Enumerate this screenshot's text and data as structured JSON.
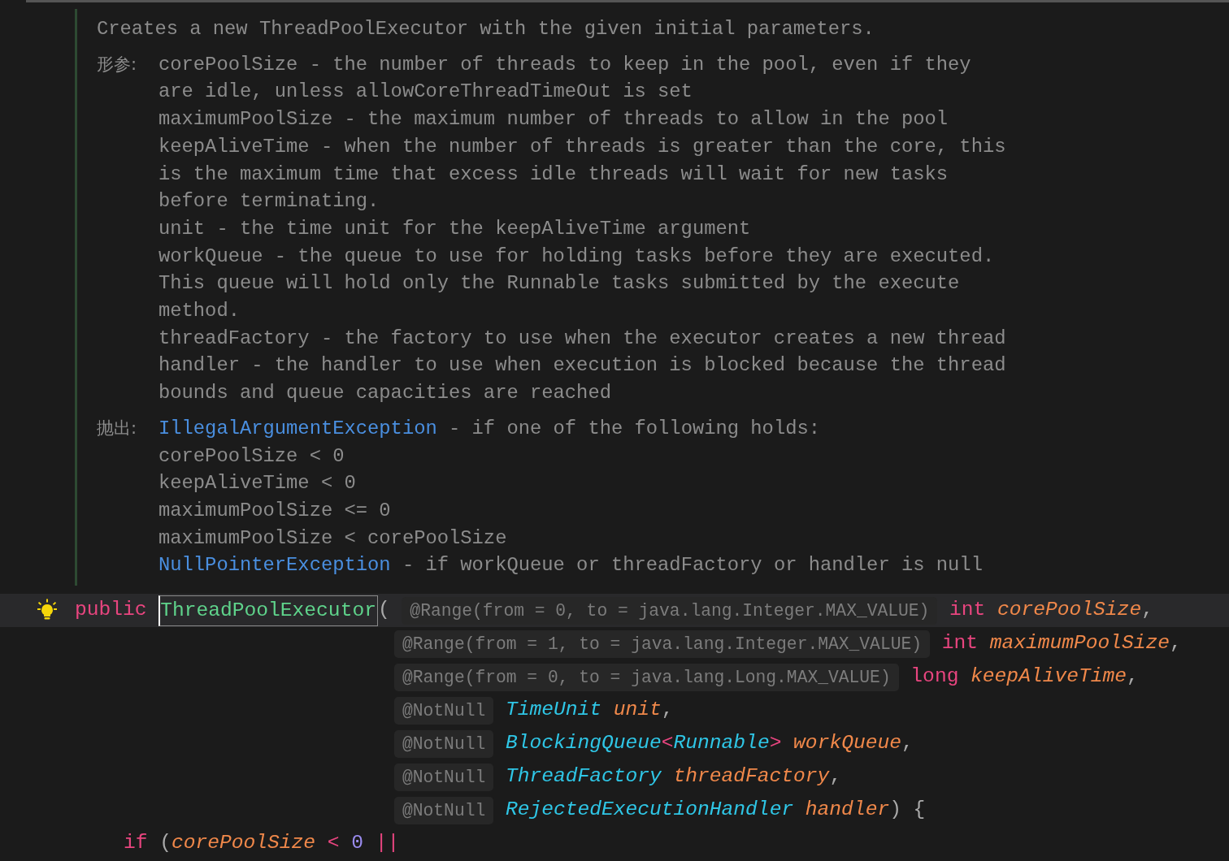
{
  "doc": {
    "summary": "Creates a new ThreadPoolExecutor with the given initial parameters.",
    "sections": [
      {
        "label": "形参:",
        "lines": [
          [
            {
              "text": "corePoolSize - the number of threads to keep in the pool, even if they",
              "kind": "text"
            }
          ],
          [
            {
              "text": "are idle, unless allowCoreThreadTimeOut is set",
              "kind": "text"
            }
          ],
          [
            {
              "text": "maximumPoolSize - the maximum number of threads to allow in the pool",
              "kind": "text"
            }
          ],
          [
            {
              "text": "keepAliveTime - when the number of threads is greater than the core, this",
              "kind": "text"
            }
          ],
          [
            {
              "text": "is the maximum time that excess idle threads will wait for new tasks",
              "kind": "text"
            }
          ],
          [
            {
              "text": "before terminating.",
              "kind": "text"
            }
          ],
          [
            {
              "text": "unit - the time unit for the keepAliveTime argument",
              "kind": "text"
            }
          ],
          [
            {
              "text": "workQueue - the queue to use for holding tasks before they are executed.",
              "kind": "text"
            }
          ],
          [
            {
              "text": "This queue will hold only the Runnable tasks submitted by the execute",
              "kind": "text"
            }
          ],
          [
            {
              "text": "method.",
              "kind": "text"
            }
          ],
          [
            {
              "text": "threadFactory - the factory to use when the executor creates a new thread",
              "kind": "text"
            }
          ],
          [
            {
              "text": "handler - the handler to use when execution is blocked because the thread",
              "kind": "text"
            }
          ],
          [
            {
              "text": "bounds and queue capacities are reached",
              "kind": "text"
            }
          ]
        ]
      },
      {
        "label": "抛出:",
        "lines": [
          [
            {
              "text": "IllegalArgumentException",
              "kind": "link"
            },
            {
              "text": "- if one of the following holds:",
              "kind": "text"
            }
          ],
          [
            {
              "text": "corePoolSize < 0",
              "kind": "text"
            }
          ],
          [
            {
              "text": "keepAliveTime < 0",
              "kind": "text"
            }
          ],
          [
            {
              "text": "maximumPoolSize <= 0",
              "kind": "text"
            }
          ],
          [
            {
              "text": "maximumPoolSize < corePoolSize",
              "kind": "text"
            }
          ],
          [
            {
              "text": "NullPointerException",
              "kind": "link"
            },
            {
              "text": "- if workQueue or threadFactory or handler is null",
              "kind": "text"
            }
          ]
        ]
      }
    ]
  },
  "code": [
    {
      "kind": "signature",
      "current": true,
      "tokens": [
        {
          "text": "public",
          "kind": "keyword"
        },
        {
          "text": "ThreadPoolExecutor",
          "kind": "declaration",
          "gap": true
        },
        {
          "text": "(",
          "kind": "punct"
        },
        {
          "text": "@Range(from = 0, to = java.lang.Integer.MAX_VALUE)",
          "kind": "hint",
          "gap": true
        },
        {
          "text": "int",
          "kind": "keyword",
          "gap": true
        },
        {
          "text": "corePoolSize",
          "kind": "param",
          "gap": true
        },
        {
          "text": ",",
          "kind": "punct"
        }
      ]
    },
    {
      "kind": "continuation",
      "tokens": [
        {
          "text": "@Range(from = 1, to = java.lang.Integer.MAX_VALUE)",
          "kind": "hint"
        },
        {
          "text": "int",
          "kind": "keyword",
          "gap": true
        },
        {
          "text": "maximumPoolSize",
          "kind": "param",
          "gap": true
        },
        {
          "text": ",",
          "kind": "punct"
        }
      ]
    },
    {
      "kind": "continuation",
      "tokens": [
        {
          "text": "@Range(from = 0, to = java.lang.Long.MAX_VALUE)",
          "kind": "hint"
        },
        {
          "text": "long",
          "kind": "keyword",
          "gap": true
        },
        {
          "text": "keepAliveTime",
          "kind": "param",
          "gap": true
        },
        {
          "text": ",",
          "kind": "punct"
        }
      ]
    },
    {
      "kind": "continuation",
      "tokens": [
        {
          "text": "@NotNull",
          "kind": "hint"
        },
        {
          "text": "TimeUnit",
          "kind": "type",
          "gap": true
        },
        {
          "text": "unit",
          "kind": "param",
          "gap": true
        },
        {
          "text": ",",
          "kind": "punct"
        }
      ]
    },
    {
      "kind": "continuation",
      "tokens": [
        {
          "text": "@NotNull",
          "kind": "hint"
        },
        {
          "text": "BlockingQueue",
          "kind": "type",
          "gap": true
        },
        {
          "text": "<",
          "kind": "operator"
        },
        {
          "text": "Runnable",
          "kind": "type"
        },
        {
          "text": ">",
          "kind": "operator"
        },
        {
          "text": "workQueue",
          "kind": "param",
          "gap": true
        },
        {
          "text": ",",
          "kind": "punct"
        }
      ]
    },
    {
      "kind": "continuation",
      "tokens": [
        {
          "text": "@NotNull",
          "kind": "hint"
        },
        {
          "text": "ThreadFactory",
          "kind": "type",
          "gap": true
        },
        {
          "text": "threadFactory",
          "kind": "param",
          "gap": true
        },
        {
          "text": ",",
          "kind": "punct"
        }
      ]
    },
    {
      "kind": "continuation",
      "tokens": [
        {
          "text": "@NotNull",
          "kind": "hint"
        },
        {
          "text": "RejectedExecutionHandler",
          "kind": "type",
          "gap": true
        },
        {
          "text": "handler",
          "kind": "param",
          "gap": true
        },
        {
          "text": ")",
          "kind": "punct"
        },
        {
          "text": "{",
          "kind": "punct",
          "gap": true
        }
      ]
    },
    {
      "kind": "body",
      "tokens": [
        {
          "text": "if",
          "kind": "keyword"
        },
        {
          "text": "(",
          "kind": "punct",
          "gap": true
        },
        {
          "text": "corePoolSize",
          "kind": "param"
        },
        {
          "text": "<",
          "kind": "operator",
          "gap": true
        },
        {
          "text": "0",
          "kind": "number",
          "gap": true
        },
        {
          "text": "||",
          "kind": "operator",
          "gap": true
        }
      ]
    }
  ]
}
